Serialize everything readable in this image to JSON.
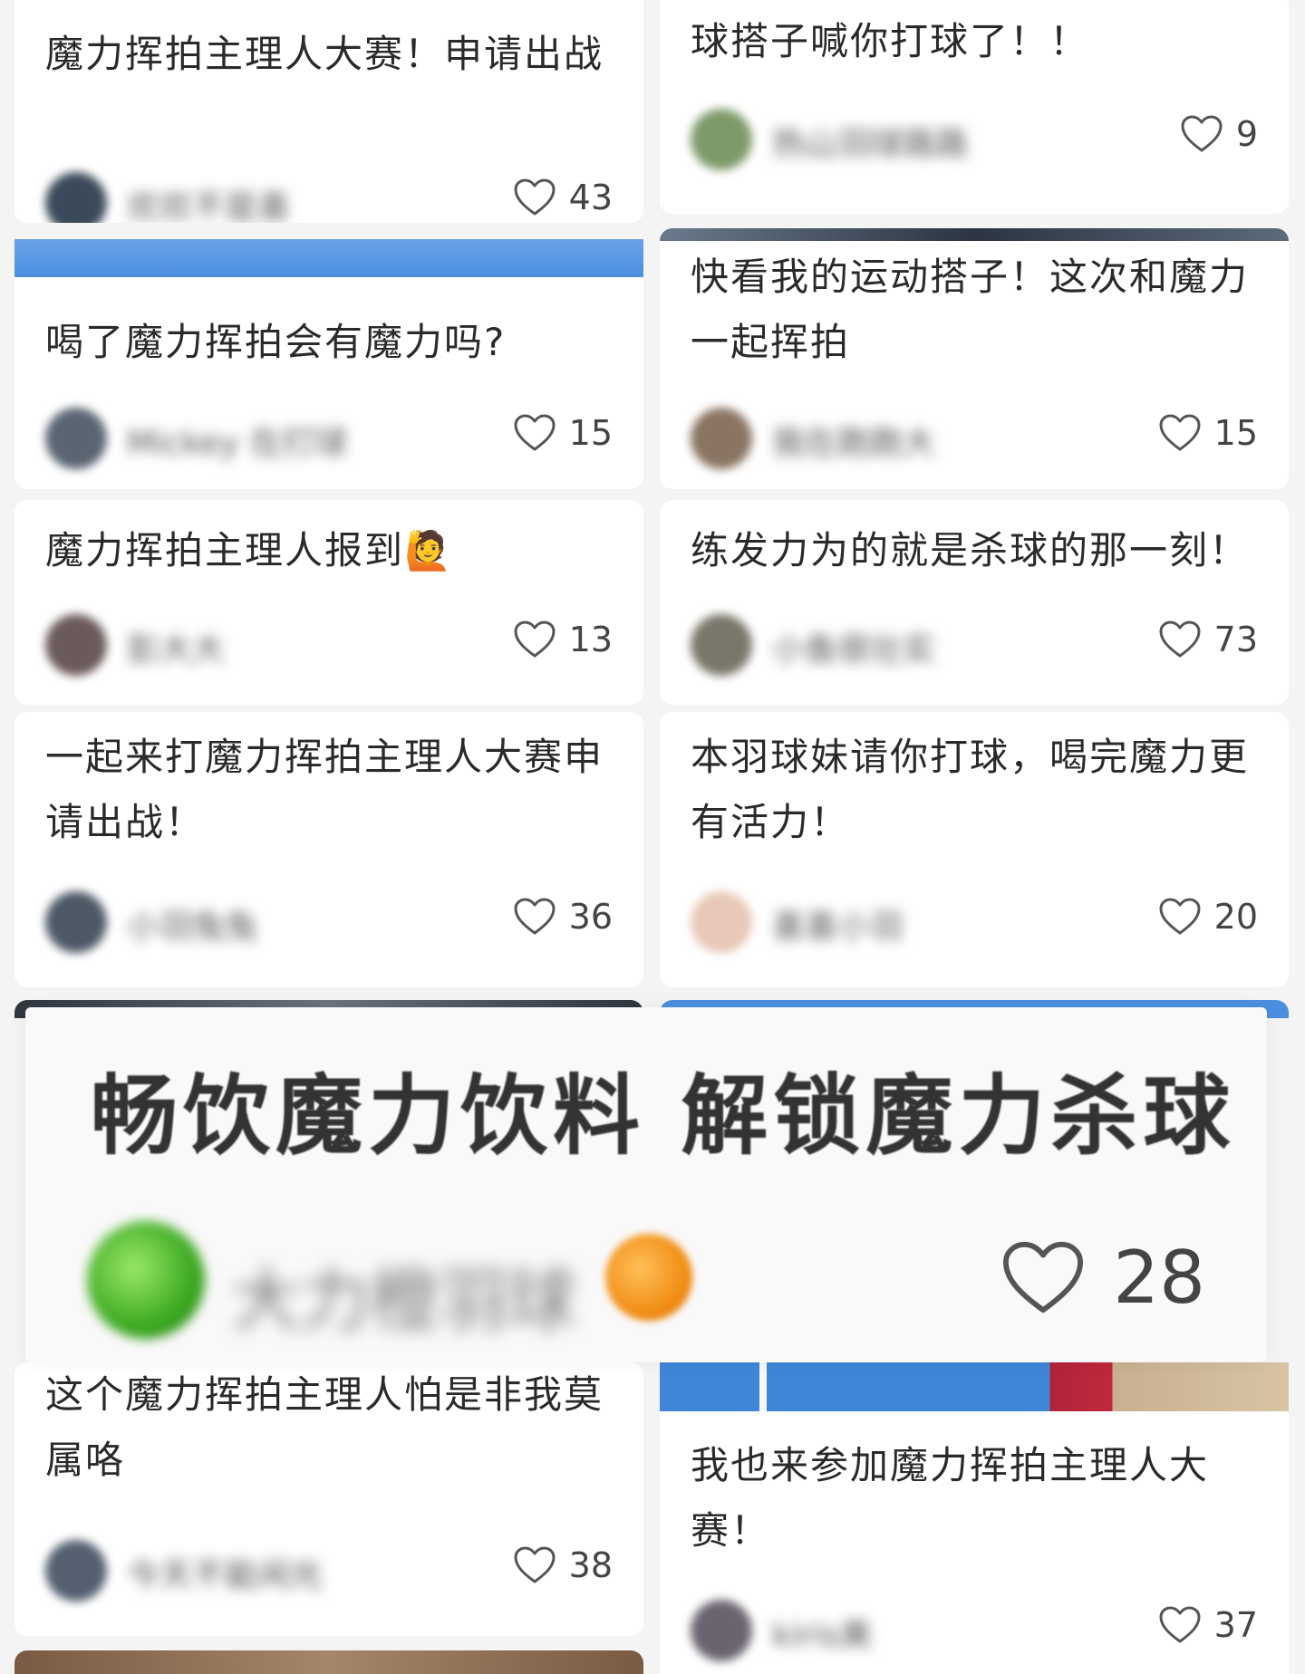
{
  "cards": [
    {
      "title": "魔力挥拍主理人大赛！申请出战",
      "author": "欢欢不是喜",
      "likes": "43"
    },
    {
      "title": "球搭子喊你打球了！！",
      "author": "热山羽球路路",
      "likes": "9"
    },
    {
      "title": "喝了魔力挥拍会有魔力吗?",
      "author": "Mickey 在打球",
      "likes": "15"
    },
    {
      "title": "快看我的运动搭子！这次和魔力一起挥拍",
      "author": "我在跑跑大",
      "likes": "15"
    },
    {
      "title": "魔力挥拍主理人报到🙋",
      "author": "彭大大",
      "likes": "13"
    },
    {
      "title": "练发力为的就是杀球的那一刻！",
      "author": "小鱼很壮实",
      "likes": "73"
    },
    {
      "title": "一起来打魔力挥拍主理人大赛申请出战！",
      "author": "小羽兔兔",
      "likes": "36"
    },
    {
      "title": "本羽球妹请你打球，喝完魔力更有活力！",
      "author": "喜喜小羽",
      "likes": "20"
    },
    {
      "title": "这个魔力挥拍主理人怕是非我莫属咯",
      "author": "今天不能闲光",
      "likes": "38"
    },
    {
      "title": "我也来参加魔力挥拍主理人大赛！",
      "author": "kiris美",
      "likes": "37"
    }
  ],
  "overlay": {
    "title": "畅饮魔力饮料 解锁魔力杀球",
    "author": "大力橙羽球",
    "likes": "28"
  },
  "icons": {
    "heart": "heart-outline-icon",
    "racket": "badminton-racket-icon",
    "orange": "orange-emoji-icon"
  },
  "colors": {
    "background": "#f4f4f4",
    "card": "#ffffff",
    "text": "#2a2a2a",
    "court_blue": "#4a8fe0"
  }
}
